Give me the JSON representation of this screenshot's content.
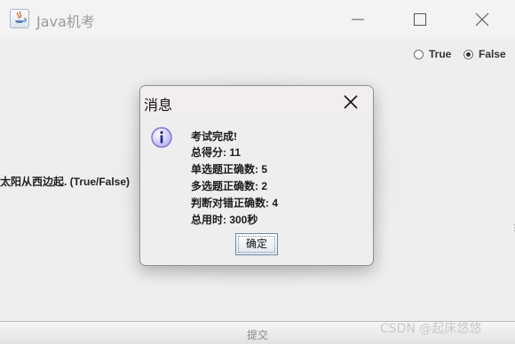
{
  "window": {
    "title": "Java机考"
  },
  "options": {
    "true_label": "True",
    "false_label": "False",
    "selected": "False"
  },
  "question": {
    "text": "太阳从西边起. (True/False)"
  },
  "submit": {
    "label": "提交"
  },
  "dialog": {
    "title": "消息",
    "lines": [
      "考试完成!",
      "总得分: 11",
      "单选题正确数: 5",
      "多选题正确数: 2",
      "判断对错正确数: 4",
      "总用时: 300秒"
    ],
    "ok_label": "确定",
    "icon": "info-icon"
  },
  "watermark": {
    "text": "CSDN @起床悠悠"
  },
  "colors": {
    "window_bg": "#eeeeee",
    "dialog_title_bg": "#f3eeee",
    "info_icon": "#6b63d8"
  }
}
